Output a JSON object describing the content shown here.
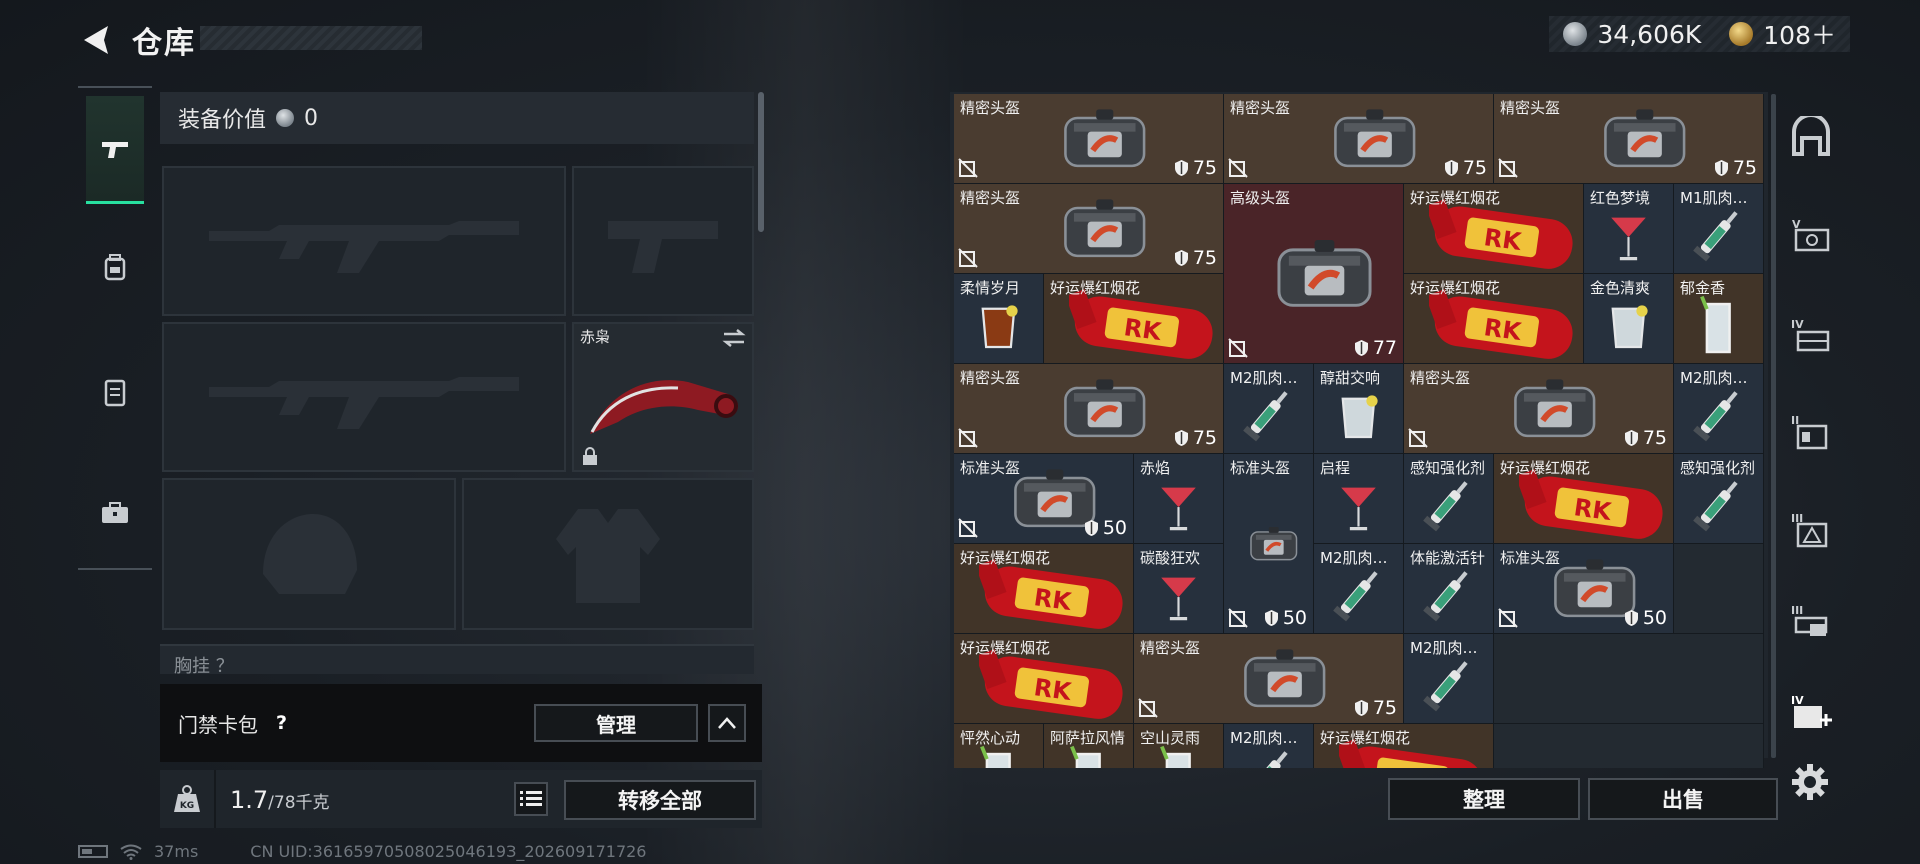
{
  "header": {
    "title": "仓库"
  },
  "currency": {
    "silver": "34,606K",
    "gold": "108＋"
  },
  "equipment": {
    "value_label": "装备价值",
    "value": "0",
    "melee_name": "赤枭",
    "chest_label": "胸挂 ？"
  },
  "keycard": {
    "label": "门禁卡包",
    "help": "?",
    "manage_label": "管理"
  },
  "weight": {
    "current": "1.7",
    "max": "/78千克"
  },
  "transfer_label": "转移全部",
  "status": {
    "ping": "37ms",
    "uid": "CN UID:3616597050802504619З_202609171726"
  },
  "inventory": {
    "sort_label": "整理",
    "sell_label": "出售",
    "items": [
      {
        "id": "a1",
        "name": "精密头盔",
        "dur": "75",
        "type": "helmet"
      },
      {
        "id": "a2",
        "name": "精密头盔",
        "dur": "75",
        "type": "helmet"
      },
      {
        "id": "a3",
        "name": "精密头盔",
        "dur": "75",
        "type": "helmet"
      },
      {
        "id": "b1",
        "name": "精密头盔",
        "dur": "75",
        "type": "helmet"
      },
      {
        "id": "b2",
        "name": "高级头盔",
        "dur": "77",
        "type": "helmet"
      },
      {
        "id": "b3",
        "name": "好运爆红烟花",
        "type": "firework"
      },
      {
        "id": "b4",
        "name": "红色梦境",
        "type": "cocktail"
      },
      {
        "id": "b5",
        "name": "M1肌肉…",
        "type": "syringe"
      },
      {
        "id": "c1",
        "name": "柔情岁月",
        "type": "whisky"
      },
      {
        "id": "c2",
        "name": "好运爆红烟花",
        "type": "firework"
      },
      {
        "id": "c3",
        "name": "好运爆红烟花",
        "type": "firework"
      },
      {
        "id": "c4",
        "name": "金色清爽",
        "type": "ice"
      },
      {
        "id": "c5",
        "name": "郁金香",
        "type": "tall"
      },
      {
        "id": "d1",
        "name": "精密头盔",
        "dur": "75",
        "type": "helmet"
      },
      {
        "id": "d2",
        "name": "M2肌肉…",
        "type": "syringe"
      },
      {
        "id": "d3",
        "name": "醇甜交响",
        "type": "ice"
      },
      {
        "id": "d4",
        "name": "精密头盔",
        "dur": "75",
        "type": "helmet"
      },
      {
        "id": "d5",
        "name": "M2肌肉…",
        "type": "syringe"
      },
      {
        "id": "e1",
        "name": "标准头盔",
        "dur": "50",
        "type": "helmet"
      },
      {
        "id": "e2",
        "name": "赤焰",
        "type": "cocktail"
      },
      {
        "id": "e3",
        "name": "标准头盔",
        "dur": "50",
        "type": "helmet-tall"
      },
      {
        "id": "e4",
        "name": "启程",
        "type": "cocktail"
      },
      {
        "id": "e5",
        "name": "感知强化剂",
        "type": "syringe"
      },
      {
        "id": "e6",
        "name": "好运爆红烟花",
        "type": "firework"
      },
      {
        "id": "e7",
        "name": "感知强化剂",
        "type": "syringe"
      },
      {
        "id": "f1",
        "name": "好运爆红烟花",
        "type": "firework"
      },
      {
        "id": "f2",
        "name": "碳酸狂欢",
        "type": "cocktail"
      },
      {
        "id": "f3",
        "name": "M2肌肉…",
        "type": "syringe"
      },
      {
        "id": "f4",
        "name": "体能激活针",
        "type": "syringe"
      },
      {
        "id": "f5",
        "name": "标准头盔",
        "dur": "50",
        "type": "helmet"
      },
      {
        "id": "g1",
        "name": "好运爆红烟花",
        "type": "firework"
      },
      {
        "id": "g2",
        "name": "精密头盔",
        "dur": "75",
        "type": "helmet"
      },
      {
        "id": "g3",
        "name": "M2肌肉…",
        "type": "syringe"
      },
      {
        "id": "h1",
        "name": "怦然心动",
        "type": "tall"
      },
      {
        "id": "h2",
        "name": "阿萨拉风情",
        "type": "tall"
      },
      {
        "id": "h3",
        "name": "空山灵雨",
        "type": "tall"
      },
      {
        "id": "h4",
        "name": "M2肌肉…",
        "type": "syringe"
      },
      {
        "id": "h5",
        "name": "好运爆红烟花",
        "type": "firework"
      }
    ]
  },
  "colors": {
    "accent": "#28e0a0",
    "rarity_gold": "#4a3c30",
    "rarity_red": "#4a2428",
    "rarity_blue": "#26303d"
  }
}
